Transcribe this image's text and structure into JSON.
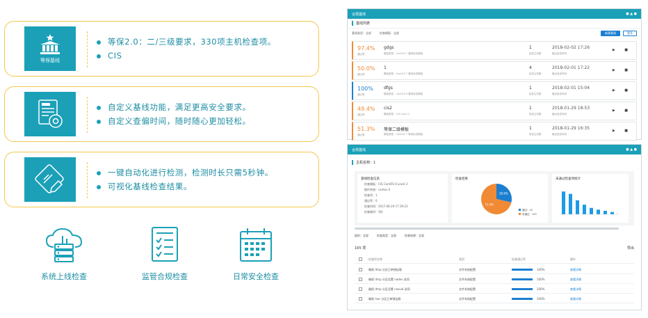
{
  "features": [
    {
      "icon": "temple-icon",
      "caption": "等保基线",
      "lines": [
        "等保2.0：二/三级要求，330项主机检查项。",
        "CIS"
      ]
    },
    {
      "icon": "document-gear-icon",
      "caption": "",
      "lines": [
        "自定义基线功能，满足更高安全要求。",
        "自定义查偏时间，随时随心更加轻松。"
      ]
    },
    {
      "icon": "pencil-icon",
      "caption": "",
      "lines": [
        "一键自动化进行检测，检测时长只需5秒钟。",
        "可视化基线检查结果。"
      ]
    }
  ],
  "bottom_icons": [
    {
      "icon": "cloud-server-icon",
      "label": "系统上线检查"
    },
    {
      "icon": "checklist-icon",
      "label": "监管合规检查"
    },
    {
      "icon": "calendar-icon",
      "label": "日常安全检查"
    }
  ],
  "shot1": {
    "title": "合规基线",
    "subtitle": "基线列表",
    "filter1": "基线类型：全部",
    "filter2": "检查模板：全部",
    "btn_primary": "新建基线",
    "btn_secondary": "更多",
    "rows": [
      {
        "pct": "97.4%",
        "pct_sub": "通过率",
        "name": "gdgs",
        "desc": "模板类型：CentOS 7 基线检查模板",
        "num": "1",
        "num_sub": "检查主机数",
        "time": "2018-02-02 17:26",
        "time_sub": "最近检查时间",
        "color": "orange"
      },
      {
        "pct": "50.0%",
        "pct_sub": "通过率",
        "name": "1",
        "desc": "模板类型：CentOS 7 基线检查模板",
        "num": "4",
        "num_sub": "检查主机数",
        "time": "2018-02-01 17:22",
        "time_sub": "最近检查时间",
        "color": "orange"
      },
      {
        "pct": "100%",
        "pct_sub": "通过率",
        "name": "dfgs",
        "desc": "模板类型：CentOS 6 基线检查模板",
        "num": "1",
        "num_sub": "检查主机数",
        "time": "2018-02-01 15:04",
        "time_sub": "最近检查时间",
        "color": "blue"
      },
      {
        "pct": "49.4%",
        "pct_sub": "通过率",
        "name": "cis2",
        "desc": "模板类型：CIS Level 2",
        "num": "1",
        "num_sub": "检查主机数",
        "time": "2018-01-29 18:53",
        "time_sub": "最近检查时间",
        "color": "orange"
      },
      {
        "pct": "51.3%",
        "pct_sub": "通过率",
        "name": "等保二级模板",
        "desc": "模板类型：CentOS 7 等保检查模板",
        "num": "1",
        "num_sub": "检查主机数",
        "time": "2018-01-29 16:35",
        "time_sub": "最近检查时间",
        "color": "orange"
      }
    ]
  },
  "shot2": {
    "title": "合规基线",
    "subtitle": "主机名称：1",
    "card1_title": "基线检查信息",
    "card1_kv": [
      "检查模板：CIS CentOS 6 Level 2",
      "操作系统：centos 6",
      "检查项：1",
      "通过率：0",
      "检查时间：2017-06-29 17:39:23",
      "检查耗时：5秒"
    ],
    "card2_title": "检查结果",
    "card3_title": "未通过检查项统计",
    "legend": [
      "通过：40",
      "未通过：100"
    ],
    "filters": [
      "级别：全部",
      "检查类型：全部",
      "检查结果：全部"
    ],
    "table_count": "165 项",
    "table_right": "导出",
    "cols": [
      "检查项名称",
      "类别",
      "检查通过率",
      "操作"
    ],
    "rows": [
      {
        "name": "确保 /tmp 分区已单独挂载",
        "cat": "文件系统配置",
        "pct": "100%",
        "op": "查看详情"
      },
      {
        "name": "确保 /tmp 分区设置 nodev 选项",
        "cat": "文件系统配置",
        "pct": "100%",
        "op": "查看详情"
      },
      {
        "name": "确保 /tmp 分区设置 nosuid 选项",
        "cat": "文件系统配置",
        "pct": "100%",
        "op": "查看详情"
      },
      {
        "name": "确保 /var 分区已单独挂载",
        "cat": "文件系统配置",
        "pct": "100%",
        "op": "查看详情"
      }
    ]
  },
  "chart_data": {
    "type": "pie",
    "labels": [
      "通过",
      "未通过"
    ],
    "values": [
      40,
      100
    ],
    "slice_labels": [
      "28.6%",
      "71.4%"
    ],
    "colors": [
      "#1b7fd1",
      "#f08a34"
    ]
  },
  "chart_data_bar": {
    "type": "bar",
    "values": [
      78,
      70,
      48,
      33,
      22,
      16,
      12,
      8
    ]
  },
  "colors": {
    "accent": "#1ba0b8",
    "border": "#f2c94c",
    "text": "#1e8ea4",
    "orange": "#f08a34",
    "blue": "#1b7fd1"
  }
}
